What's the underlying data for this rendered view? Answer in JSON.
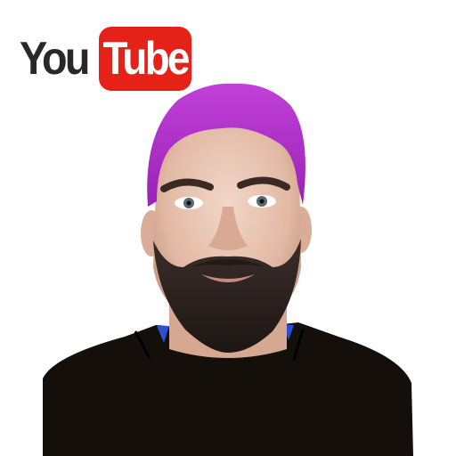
{
  "logo": {
    "left_text": "You",
    "right_text": "Tube",
    "brand_red": "#e62117",
    "text_dark": "#282828"
  },
  "portrait": {
    "subject": "man-with-purple-hair-and-beard",
    "hair_color": "#b030c8",
    "beard_color": "#2a2220",
    "shirt_color": "#140f0a",
    "skin_color": "#e8c8b8"
  }
}
